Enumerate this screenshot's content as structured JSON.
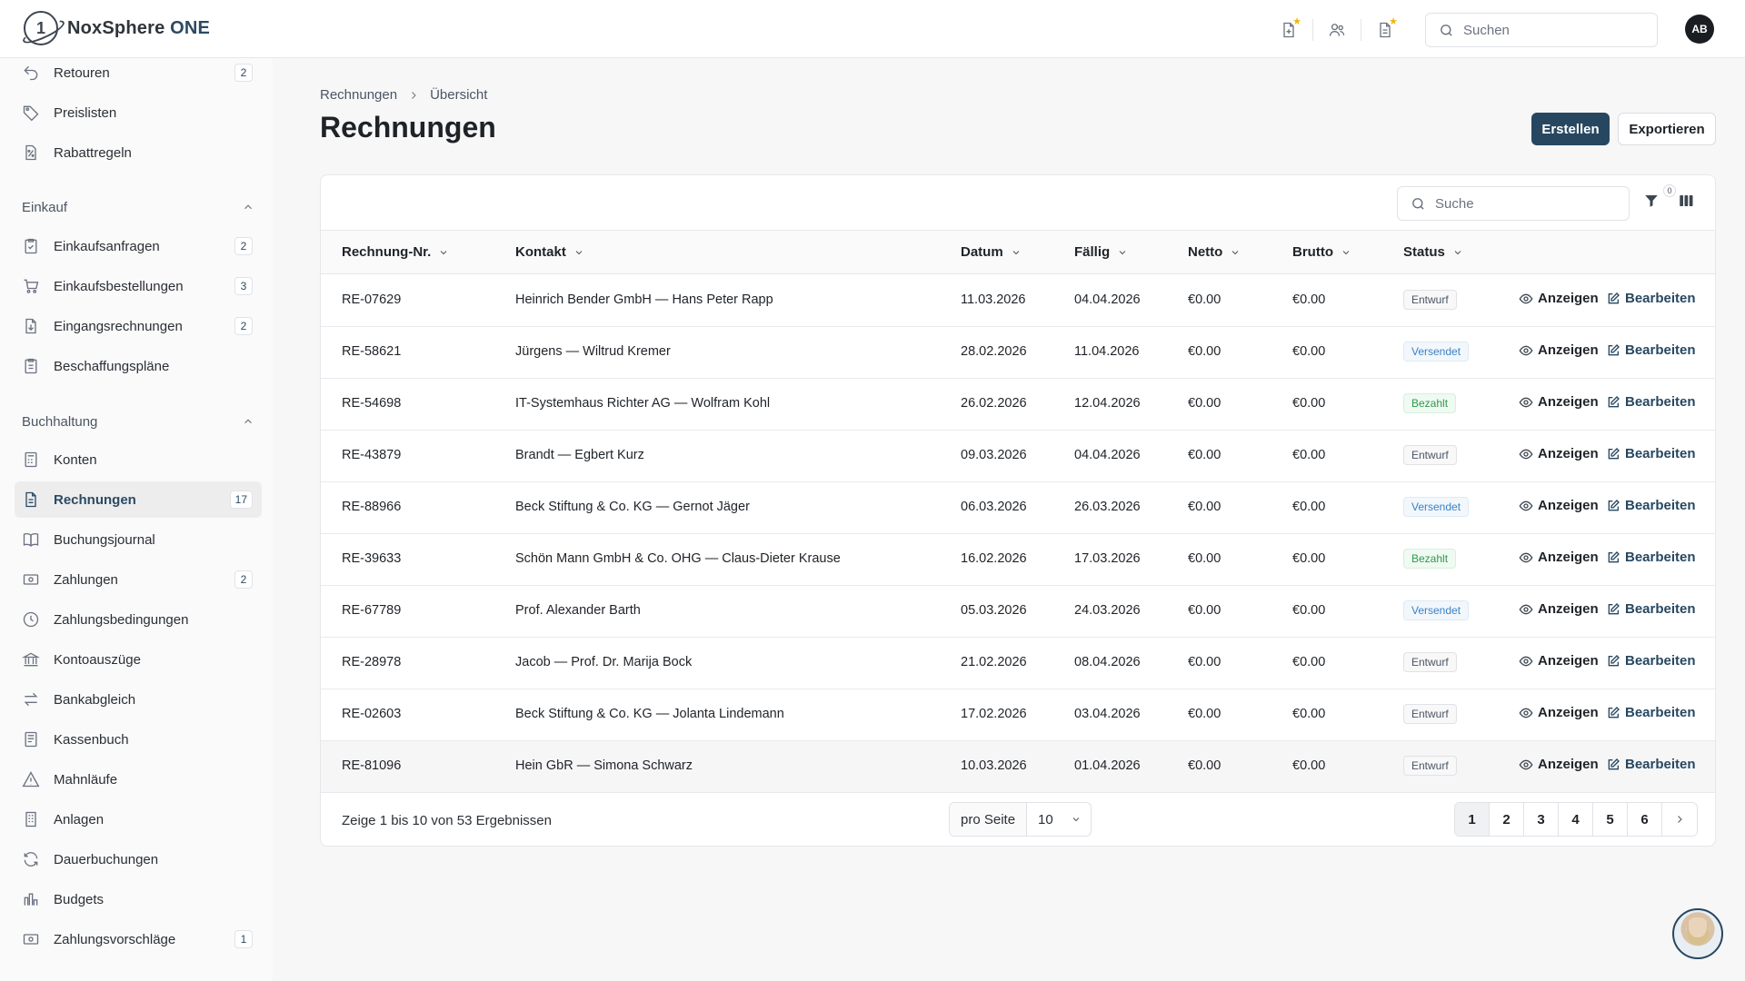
{
  "app": {
    "brand_main": "NoxSphere",
    "brand_accent": "ONE",
    "logo_mark": "1",
    "search_placeholder": "Suchen",
    "avatar_initials": "AB"
  },
  "top_icons": [
    "file-plus-icon",
    "users-icon",
    "document-icon"
  ],
  "sidebar": {
    "group_items_top": [
      {
        "label": "Retouren",
        "badge": "2",
        "icon": "return-icon"
      },
      {
        "label": "Preislisten",
        "badge": "",
        "icon": "tag-icon"
      },
      {
        "label": "Rabattregeln",
        "badge": "",
        "icon": "percent-icon"
      }
    ],
    "einkauf": {
      "title": "Einkauf",
      "items": [
        {
          "label": "Einkaufsanfragen",
          "badge": "2",
          "icon": "clipboard-check-icon"
        },
        {
          "label": "Einkaufsbestellungen",
          "badge": "3",
          "icon": "cart-icon"
        },
        {
          "label": "Eingangsrechnungen",
          "badge": "2",
          "icon": "file-download-icon"
        },
        {
          "label": "Beschaffungspläne",
          "badge": "",
          "icon": "clipboard-list-icon"
        }
      ]
    },
    "buchhaltung": {
      "title": "Buchhaltung",
      "items": [
        {
          "label": "Konten",
          "badge": "",
          "icon": "calculator-icon"
        },
        {
          "label": "Rechnungen",
          "badge": "17",
          "icon": "invoice-icon"
        },
        {
          "label": "Buchungsjournal",
          "badge": "",
          "icon": "book-icon"
        },
        {
          "label": "Zahlungen",
          "badge": "2",
          "icon": "cash-icon"
        },
        {
          "label": "Zahlungsbedingungen",
          "badge": "",
          "icon": "clock-icon"
        },
        {
          "label": "Kontoauszüge",
          "badge": "",
          "icon": "bank-icon"
        },
        {
          "label": "Bankabgleich",
          "badge": "",
          "icon": "arrows-icon"
        },
        {
          "label": "Kassenbuch",
          "badge": "",
          "icon": "register-icon"
        },
        {
          "label": "Mahnläufe",
          "badge": "",
          "icon": "warning-icon"
        },
        {
          "label": "Anlagen",
          "badge": "",
          "icon": "building-icon"
        },
        {
          "label": "Dauerbuchungen",
          "badge": "",
          "icon": "refresh-icon"
        },
        {
          "label": "Budgets",
          "badge": "",
          "icon": "bar-chart-icon"
        },
        {
          "label": "Zahlungsvorschläge",
          "badge": "1",
          "icon": "cash-icon"
        }
      ]
    }
  },
  "breadcrumb": {
    "root": "Rechnungen",
    "current": "Übersicht"
  },
  "page": {
    "title": "Rechnungen",
    "create_label": "Erstellen",
    "export_label": "Exportieren"
  },
  "table": {
    "search_placeholder": "Suche",
    "filter_count": "0",
    "columns": [
      "Rechnung-Nr.",
      "Kontakt",
      "Datum",
      "Fällig",
      "Netto",
      "Brutto",
      "Status"
    ],
    "view_label": "Anzeigen",
    "edit_label": "Bearbeiten",
    "rows": [
      {
        "nr": "RE-07629",
        "kontakt": "Heinrich Bender GmbH — Hans Peter Rapp",
        "datum": "11.03.2026",
        "faellig": "04.04.2026",
        "netto": "€0.00",
        "brutto": "€0.00",
        "status": "Entwurf"
      },
      {
        "nr": "RE-58621",
        "kontakt": "Jürgens — Wiltrud Kremer",
        "datum": "28.02.2026",
        "faellig": "11.04.2026",
        "netto": "€0.00",
        "brutto": "€0.00",
        "status": "Versendet"
      },
      {
        "nr": "RE-54698",
        "kontakt": "IT-Systemhaus Richter AG — Wolfram Kohl",
        "datum": "26.02.2026",
        "faellig": "12.04.2026",
        "netto": "€0.00",
        "brutto": "€0.00",
        "status": "Bezahlt"
      },
      {
        "nr": "RE-43879",
        "kontakt": "Brandt — Egbert Kurz",
        "datum": "09.03.2026",
        "faellig": "04.04.2026",
        "netto": "€0.00",
        "brutto": "€0.00",
        "status": "Entwurf"
      },
      {
        "nr": "RE-88966",
        "kontakt": "Beck Stiftung & Co. KG — Gernot Jäger",
        "datum": "06.03.2026",
        "faellig": "26.03.2026",
        "netto": "€0.00",
        "brutto": "€0.00",
        "status": "Versendet"
      },
      {
        "nr": "RE-39633",
        "kontakt": "Schön Mann GmbH & Co. OHG — Claus-Dieter Krause",
        "datum": "16.02.2026",
        "faellig": "17.03.2026",
        "netto": "€0.00",
        "brutto": "€0.00",
        "status": "Bezahlt"
      },
      {
        "nr": "RE-67789",
        "kontakt": "Prof. Alexander Barth",
        "datum": "05.03.2026",
        "faellig": "24.03.2026",
        "netto": "€0.00",
        "brutto": "€0.00",
        "status": "Versendet"
      },
      {
        "nr": "RE-28978",
        "kontakt": "Jacob — Prof. Dr. Marija Bock",
        "datum": "21.02.2026",
        "faellig": "08.04.2026",
        "netto": "€0.00",
        "brutto": "€0.00",
        "status": "Entwurf"
      },
      {
        "nr": "RE-02603",
        "kontakt": "Beck Stiftung & Co. KG — Jolanta Lindemann",
        "datum": "17.02.2026",
        "faellig": "03.04.2026",
        "netto": "€0.00",
        "brutto": "€0.00",
        "status": "Entwurf"
      },
      {
        "nr": "RE-81096",
        "kontakt": "Hein GbR — Simona Schwarz",
        "datum": "10.03.2026",
        "faellig": "01.04.2026",
        "netto": "€0.00",
        "brutto": "€0.00",
        "status": "Entwurf"
      }
    ]
  },
  "footer": {
    "summary": "Zeige 1 bis 10 von 53 Ergebnissen",
    "per_page_label": "pro Seite",
    "per_page_value": "10",
    "pages": [
      "1",
      "2",
      "3",
      "4",
      "5",
      "6"
    ],
    "current_page": "1"
  },
  "colors": {
    "primary": "#274760",
    "versendet": "#3b82c4",
    "bezahlt": "#2e9a4c",
    "star": "#f2b316"
  }
}
